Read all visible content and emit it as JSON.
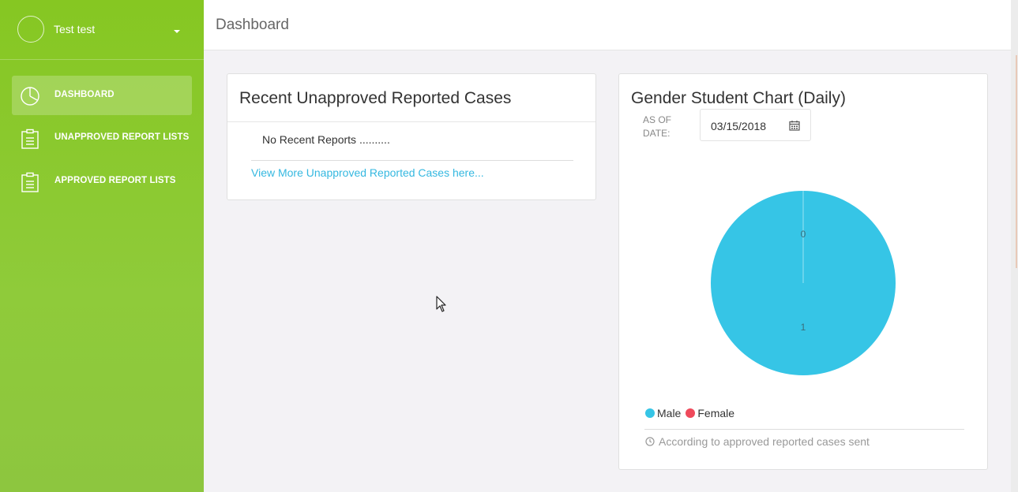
{
  "user": {
    "name": "Test test"
  },
  "nav": {
    "items": [
      {
        "label": "DASHBOARD",
        "icon": "pie-chart-icon",
        "active": true
      },
      {
        "label": "UNAPPROVED REPORT LISTS",
        "icon": "clipboard-icon",
        "active": false
      },
      {
        "label": "APPROVED REPORT LISTS",
        "icon": "clipboard-icon",
        "active": false
      }
    ]
  },
  "header": {
    "title": "Dashboard"
  },
  "recent_cases": {
    "title": "Recent Unapproved Reported Cases",
    "empty_message": "No Recent Reports ..........",
    "more_link": "View More Unapproved Reported Cases here..."
  },
  "gender_chart": {
    "title": "Gender Student Chart (Daily)",
    "asof_line1": "AS OF",
    "asof_line2": "DATE:",
    "date_value": "03/15/2018",
    "footer_note": "According to approved reported cases sent"
  },
  "colors": {
    "sidebar": "#86c722",
    "male": "#36c5e6",
    "female": "#ef4a5b",
    "link": "#35b8e0"
  },
  "chart_data": {
    "type": "pie",
    "categories": [
      "Male",
      "Female"
    ],
    "values": [
      1,
      0
    ],
    "colors": [
      "#36c5e6",
      "#ef4a5b"
    ],
    "legend": "bottom-left"
  }
}
